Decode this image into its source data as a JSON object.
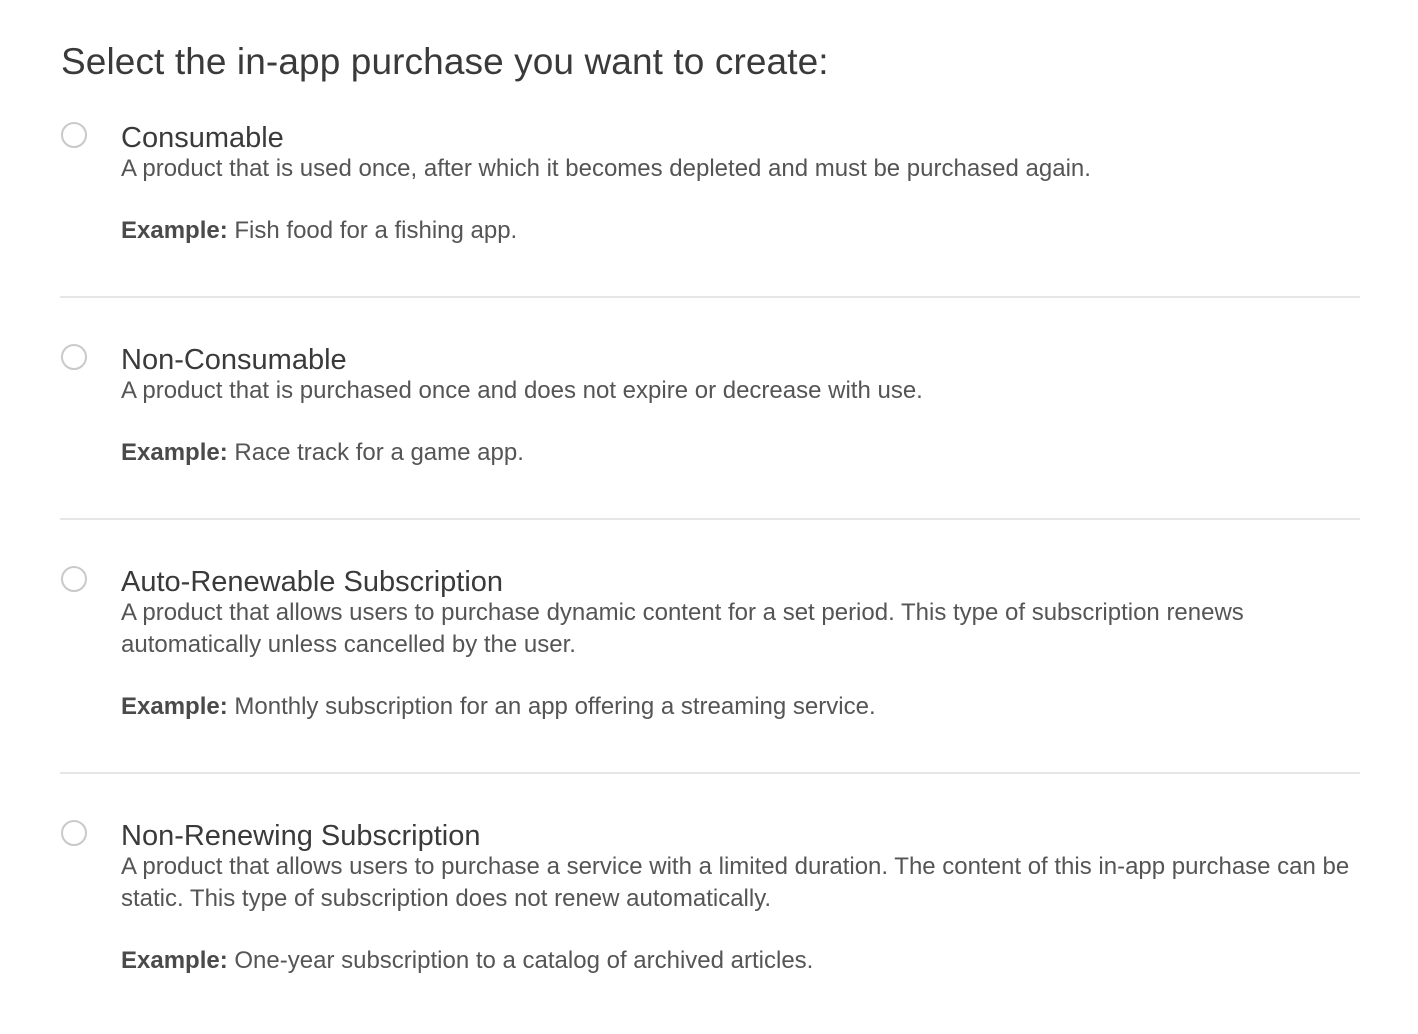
{
  "page": {
    "title": "Select the in-app purchase you want to create:"
  },
  "options": [
    {
      "title": "Consumable",
      "description": "A product that is used once, after which it becomes depleted and must be purchased again.",
      "example_label": "Example:",
      "example_text": "Fish food for a fishing app.",
      "selected": false
    },
    {
      "title": "Non-Consumable",
      "description": "A product that is purchased once and does not expire or decrease with use.",
      "example_label": "Example:",
      "example_text": "Race track for a game app.",
      "selected": false
    },
    {
      "title": "Auto-Renewable Subscription",
      "description": "A product that allows users to purchase dynamic content for a set period. This type of subscription renews automatically unless cancelled by the user.",
      "example_label": "Example:",
      "example_text": "Monthly subscription for an app offering a streaming service.",
      "selected": false
    },
    {
      "title": "Non-Renewing Subscription",
      "description": "A product that allows users to purchase a service with a limited duration. The content of this in-app purchase can be static. This type of subscription does not renew automatically.",
      "example_label": "Example:",
      "example_text": "One-year subscription to a catalog of archived articles.",
      "selected": false
    }
  ],
  "colors": {
    "text_primary": "#3a3a3a",
    "text_secondary": "#555555",
    "divider": "#e6e6e6",
    "radio_border": "#c9c9c9"
  }
}
